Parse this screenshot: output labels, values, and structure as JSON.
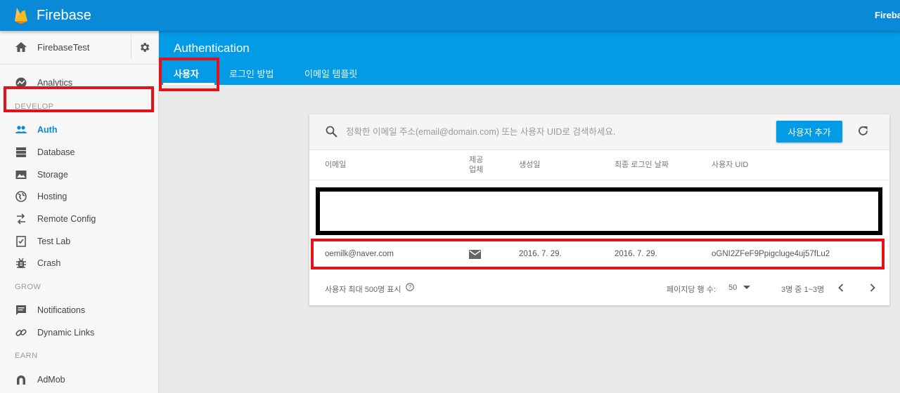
{
  "topbar": {
    "brand": "Firebase",
    "right_text": "Firebase"
  },
  "sidebar": {
    "project_name": "FirebaseTest",
    "items_top": [
      {
        "label": "Analytics",
        "icon": "analytics-icon"
      }
    ],
    "sections": [
      {
        "title": "DEVELOP",
        "items": [
          {
            "label": "Auth",
            "icon": "people-icon",
            "active": true
          },
          {
            "label": "Database",
            "icon": "database-icon"
          },
          {
            "label": "Storage",
            "icon": "storage-icon"
          },
          {
            "label": "Hosting",
            "icon": "globe-icon"
          },
          {
            "label": "Remote Config",
            "icon": "remote-config-icon"
          },
          {
            "label": "Test Lab",
            "icon": "test-lab-icon"
          },
          {
            "label": "Crash",
            "icon": "bug-icon"
          }
        ]
      },
      {
        "title": "GROW",
        "items": [
          {
            "label": "Notifications",
            "icon": "chat-icon"
          },
          {
            "label": "Dynamic Links",
            "icon": "link-icon"
          }
        ]
      },
      {
        "title": "EARN",
        "items": [
          {
            "label": "AdMob",
            "icon": "admob-icon"
          }
        ]
      }
    ]
  },
  "header": {
    "title": "Authentication",
    "tabs": [
      {
        "label": "사용자",
        "active": true
      },
      {
        "label": "로그인 방법"
      },
      {
        "label": "이메일 템플릿"
      }
    ]
  },
  "users": {
    "search_placeholder": "정확한 이메일 주소(email@domain.com) 또는 사용자 UID로 검색하세요.",
    "add_button": "사용자 추가",
    "columns": {
      "email": "이메일",
      "provider_line1": "제공",
      "provider_line2": "업체",
      "created": "생성일",
      "last_login": "최종 로그인 날짜",
      "uid": "사용자 UID"
    },
    "rows": [
      {
        "email": "oemilk@naver.com",
        "provider": "email-icon",
        "created": "2016. 7. 29.",
        "last_login": "2016. 7. 29.",
        "uid": "oGNI2ZFeF9Ppigcluge4uj57fLu2"
      }
    ],
    "footer": {
      "max_text": "사용자 최대 500명 표시",
      "per_page_label": "페이지당 행 수:",
      "per_page_value": "50",
      "range": "3명 중 1~3명"
    }
  },
  "colors": {
    "topbar": "#0a8ad6",
    "header": "#039be5",
    "accent": "#039be5",
    "highlight": "#e3131b"
  }
}
